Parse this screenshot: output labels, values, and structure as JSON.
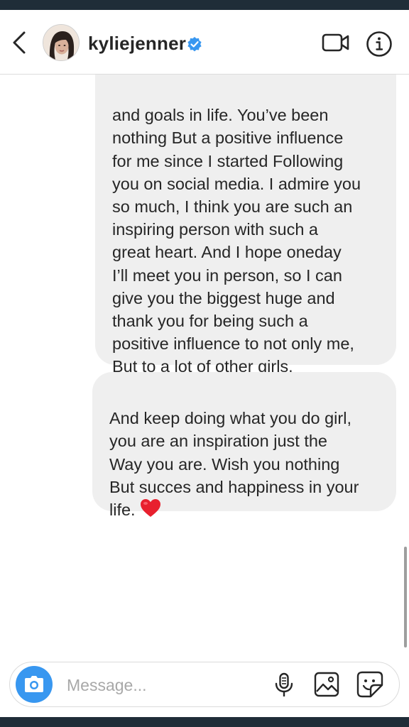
{
  "header": {
    "username": "kyliejenner",
    "verified": true,
    "icons": {
      "back": "chevron-left-icon",
      "video": "video-camera-icon",
      "info": "info-icon",
      "verified": "verified-badge-icon"
    }
  },
  "thread": {
    "messages": [
      {
        "sender": "me",
        "text": "and goals in life. You’ve been\nnothing But a positive influence\nfor me since I started Following\nyou on social media. I admire you\nso much, I think you are such an\ninspiring person with such a\ngreat heart. And I hope oneday\nI’ll meet you in person, so I can\ngive you the biggest huge and\nthank you for being such a\npositive influence to not only me,\nBut to a lot of other girls."
      },
      {
        "sender": "me",
        "text": "And keep doing what you do girl,\nyou are an inspiration just the\nWay you are. Wish you nothing\nBut succes and happiness in your\nlife.",
        "emoji": "red-heart-icon"
      }
    ]
  },
  "composer": {
    "placeholder": "Message...",
    "icons": {
      "camera": "camera-icon",
      "mic": "microphone-icon",
      "gallery": "gallery-icon",
      "sticker": "sticker-icon"
    }
  },
  "colors": {
    "accent": "#3897f0",
    "bubble": "#efefef",
    "text": "#262626",
    "placeholder": "#a8a8a8",
    "heart": "#e8202e",
    "device_frame": "#1f2d38"
  }
}
